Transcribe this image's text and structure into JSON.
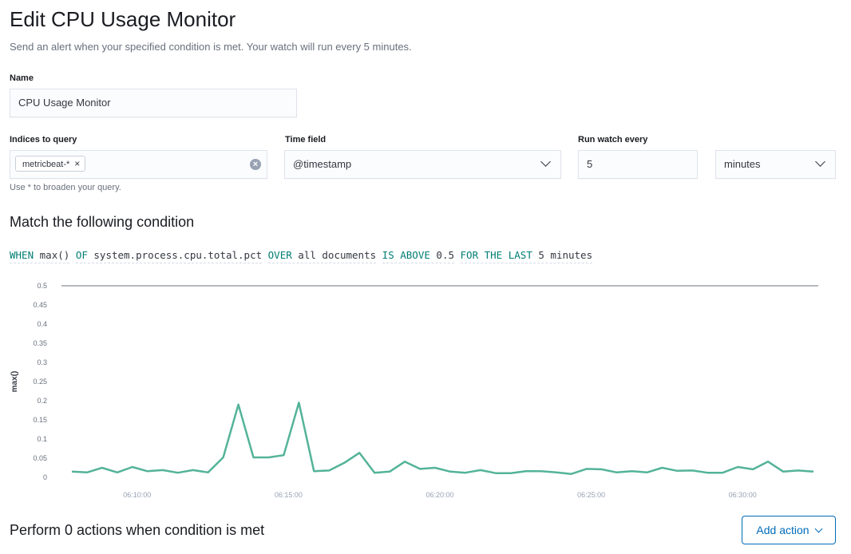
{
  "header": {
    "title": "Edit CPU Usage Monitor",
    "subtitle": "Send an alert when your specified condition is met. Your watch will run every 5 minutes."
  },
  "form": {
    "name_label": "Name",
    "name_value": "CPU Usage Monitor",
    "indices_label": "Indices to query",
    "indices_pill": "metricbeat-*",
    "indices_help": "Use * to broaden your query.",
    "time_field_label": "Time field",
    "time_field_value": "@timestamp",
    "run_every_label": "Run watch every",
    "run_every_value": "5",
    "run_every_unit": "minutes"
  },
  "condition": {
    "title": "Match the following condition",
    "tokens": [
      {
        "kw": "WHEN",
        "val": "max()"
      },
      {
        "kw": "OF",
        "val": "system.process.cpu.total.pct"
      },
      {
        "kw": "OVER",
        "val": "all documents"
      },
      {
        "kw": "IS ABOVE",
        "val": "0.5"
      },
      {
        "kw": "FOR THE LAST",
        "val": "5 minutes"
      }
    ]
  },
  "actions": {
    "title": "Perform 0 actions when condition is met",
    "add_label": "Add action"
  },
  "colors": {
    "line": "#54b399",
    "threshold": "#6a717d",
    "accent": "#006bb8"
  },
  "chart_data": {
    "type": "line",
    "ylabel": "max()",
    "xlabel": "",
    "ylim": [
      0,
      0.5
    ],
    "yticks": [
      "0",
      "0.05",
      "0.1",
      "0.15",
      "0.2",
      "0.25",
      "0.3",
      "0.35",
      "0.4",
      "0.45",
      "0.5"
    ],
    "xticks": [
      "06:10:00",
      "06:15:00",
      "06:20:00",
      "06:25:00",
      "06:30:00"
    ],
    "x_start": "06:07:30",
    "x_end": "06:32:30",
    "threshold": 0.5,
    "series": [
      {
        "values": [
          0.015,
          0.013,
          0.025,
          0.013,
          0.027,
          0.016,
          0.019,
          0.012,
          0.019,
          0.013,
          0.052,
          0.19,
          0.052,
          0.052,
          0.058,
          0.195,
          0.016,
          0.018,
          0.038,
          0.064,
          0.012,
          0.015,
          0.041,
          0.022,
          0.025,
          0.015,
          0.012,
          0.019,
          0.011,
          0.011,
          0.016,
          0.016,
          0.013,
          0.009,
          0.022,
          0.021,
          0.013,
          0.016,
          0.013,
          0.025,
          0.017,
          0.018,
          0.012,
          0.012,
          0.027,
          0.021,
          0.041,
          0.015,
          0.018,
          0.015
        ]
      }
    ]
  }
}
